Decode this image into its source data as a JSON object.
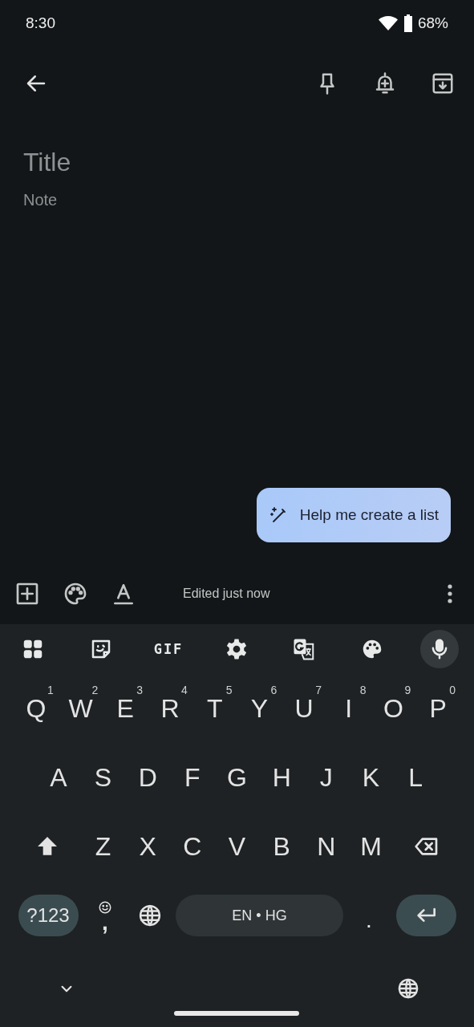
{
  "status_bar": {
    "time": "8:30",
    "battery": "68%"
  },
  "app_bar": {
    "actions": [
      {
        "kind": "pin"
      },
      {
        "kind": "reminder"
      },
      {
        "kind": "archive"
      }
    ]
  },
  "note": {
    "title_placeholder": "Title",
    "body_placeholder": "Note"
  },
  "suggestion": {
    "label": "Help me create a list"
  },
  "bottom_bar": {
    "tools": [
      {
        "kind": "add"
      },
      {
        "kind": "palette"
      },
      {
        "kind": "format"
      }
    ],
    "status": "Edited just now"
  },
  "keyboard": {
    "toolbar": [
      {
        "kind": "grid",
        "selected": false
      },
      {
        "kind": "sticker",
        "selected": false
      },
      {
        "kind": "gif",
        "label": "GIF",
        "selected": false
      },
      {
        "kind": "settings",
        "selected": false
      },
      {
        "kind": "translate",
        "selected": false
      },
      {
        "kind": "palette",
        "selected": false
      },
      {
        "kind": "mic",
        "selected": true
      }
    ],
    "rows": [
      {
        "keys": [
          {
            "kind": "letter",
            "label": "Q",
            "hint": "1"
          },
          {
            "kind": "letter",
            "label": "W",
            "hint": "2"
          },
          {
            "kind": "letter",
            "label": "E",
            "hint": "3"
          },
          {
            "kind": "letter",
            "label": "R",
            "hint": "4"
          },
          {
            "kind": "letter",
            "label": "T",
            "hint": "5"
          },
          {
            "kind": "letter",
            "label": "Y",
            "hint": "6"
          },
          {
            "kind": "letter",
            "label": "U",
            "hint": "7"
          },
          {
            "kind": "letter",
            "label": "I",
            "hint": "8"
          },
          {
            "kind": "letter",
            "label": "O",
            "hint": "9"
          },
          {
            "kind": "letter",
            "label": "P",
            "hint": "0"
          }
        ]
      },
      {
        "keys": [
          {
            "kind": "letter",
            "label": "A"
          },
          {
            "kind": "letter",
            "label": "S"
          },
          {
            "kind": "letter",
            "label": "D"
          },
          {
            "kind": "letter",
            "label": "F"
          },
          {
            "kind": "letter",
            "label": "G"
          },
          {
            "kind": "letter",
            "label": "H"
          },
          {
            "kind": "letter",
            "label": "J"
          },
          {
            "kind": "letter",
            "label": "K"
          },
          {
            "kind": "letter",
            "label": "L"
          }
        ]
      },
      {
        "keys": [
          {
            "kind": "shift"
          },
          {
            "kind": "letter",
            "label": "Z"
          },
          {
            "kind": "letter",
            "label": "X"
          },
          {
            "kind": "letter",
            "label": "C"
          },
          {
            "kind": "letter",
            "label": "V"
          },
          {
            "kind": "letter",
            "label": "B"
          },
          {
            "kind": "letter",
            "label": "N"
          },
          {
            "kind": "letter",
            "label": "M"
          },
          {
            "kind": "backspace"
          }
        ]
      },
      {
        "keys": [
          {
            "kind": "symbols",
            "label": "?123"
          },
          {
            "kind": "emoji_comma",
            "label": ","
          },
          {
            "kind": "globe"
          },
          {
            "kind": "space",
            "label": "EN • HG"
          },
          {
            "kind": "period",
            "label": "."
          },
          {
            "kind": "enter"
          }
        ]
      }
    ]
  }
}
